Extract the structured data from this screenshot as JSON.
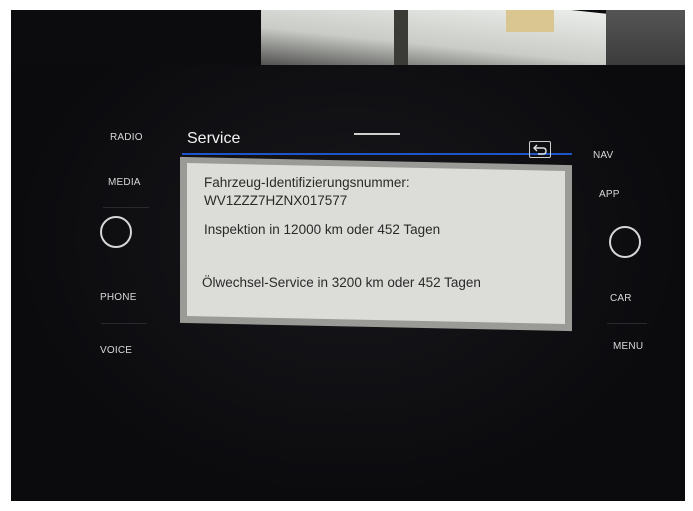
{
  "screen": {
    "title": "Service",
    "vin_label": "Fahrzeug-Identifizierungsnummer:",
    "vin_value": "WV1ZZZ7HZNX017577",
    "inspection": "Inspektion in 12000 km oder 452 Tagen",
    "oil_service": "Ölwechsel-Service in 3200 km oder 452 Tagen"
  },
  "left_buttons": [
    "RADIO",
    "MEDIA",
    "PHONE",
    "VOICE"
  ],
  "right_buttons": [
    "NAV",
    "APP",
    "CAR",
    "MENU"
  ],
  "icons": {
    "back": "back-arrow-icon",
    "left_knob": "volume-knob",
    "right_knob": "tune-knob"
  },
  "colors": {
    "accent": "#1e55c8",
    "panel_bg": "#dcdcd8",
    "bezel": "#0c0c0f"
  }
}
